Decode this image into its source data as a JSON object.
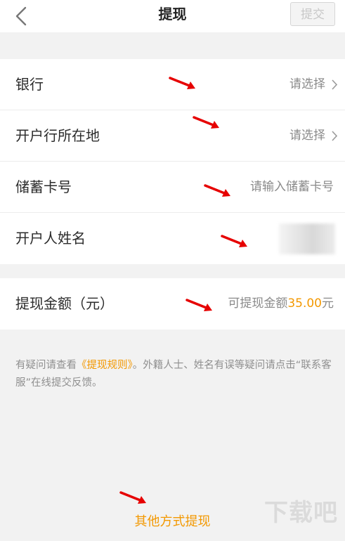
{
  "header": {
    "title": "提现",
    "submit_label": "提交"
  },
  "form": {
    "rows": [
      {
        "label": "银行",
        "value": "请选择"
      },
      {
        "label": "开户行所在地",
        "value": "请选择"
      },
      {
        "label": "储蓄卡号",
        "placeholder": "请输入储蓄卡号"
      },
      {
        "label": "开户人姓名",
        "value": ""
      }
    ],
    "amount": {
      "label": "提现金额（元）",
      "prefix": "可提现金额",
      "number": "35.00",
      "suffix": "元"
    }
  },
  "note": {
    "part1": "有疑问请查看",
    "link": "《提现规则》",
    "part2": "。外籍人士、姓名有误等疑问请点击“联系客服”在线提交反馈。"
  },
  "footer": {
    "other_method": "其他方式提现"
  },
  "watermark": "下载吧",
  "colors": {
    "accent": "#f39800",
    "annotation_arrow": "#e60000"
  },
  "icons": [
    "chevron-left-icon",
    "chevron-right-icon",
    "red-arrow-annotation"
  ]
}
